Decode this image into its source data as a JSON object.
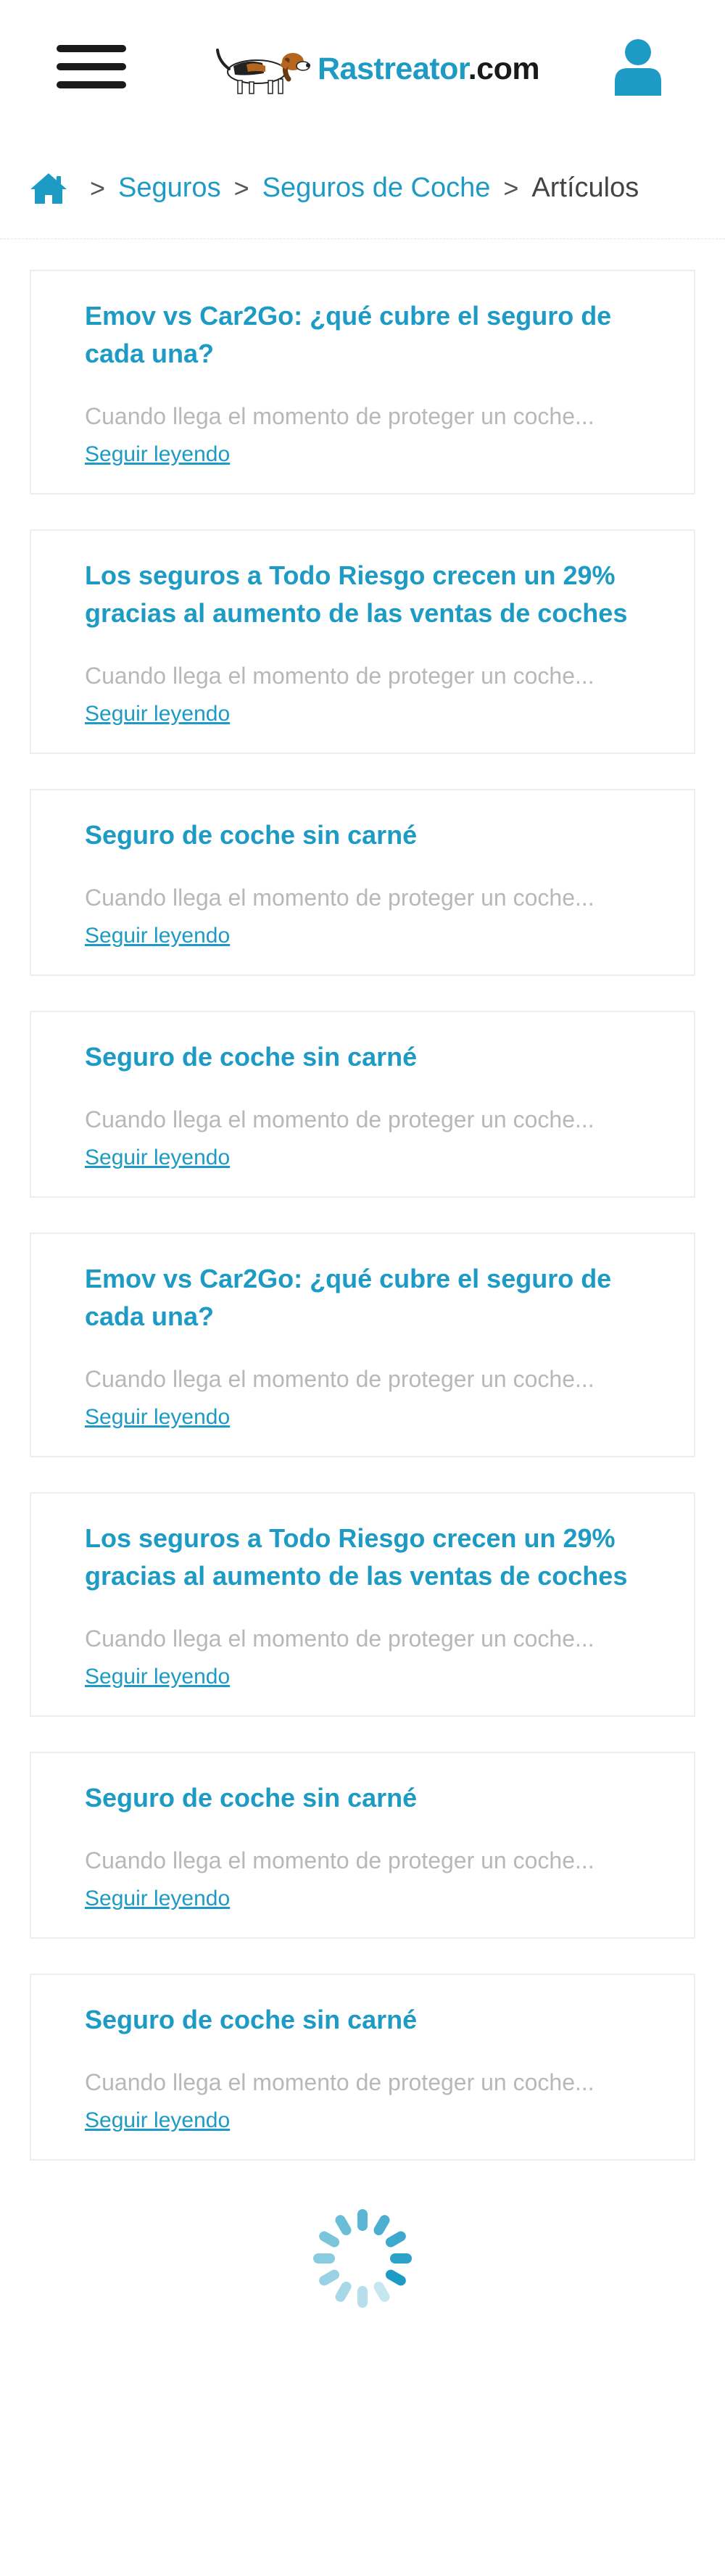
{
  "header": {
    "logo_brand": "Rastreator",
    "logo_suffix": ".com",
    "menu_icon": "hamburger-icon",
    "user_icon": "user-icon"
  },
  "breadcrumb": {
    "home_icon": "home-icon",
    "separator": ">",
    "items": [
      {
        "label": "Seguros"
      },
      {
        "label": "Seguros de Coche"
      }
    ],
    "current": "Artículos"
  },
  "articles": [
    {
      "title": "Emov vs Car2Go: ¿qué cubre el seguro de cada una?",
      "excerpt": "Cuando llega el momento de proteger un coche...",
      "link": "Seguir leyendo"
    },
    {
      "title": "Los seguros a Todo Riesgo crecen un 29% gracias al aumento de las ventas de coches",
      "excerpt": "Cuando llega el momento de proteger un coche...",
      "link": "Seguir leyendo"
    },
    {
      "title": "Seguro de coche sin carné",
      "excerpt": "Cuando llega el momento de proteger un coche...",
      "link": "Seguir leyendo"
    },
    {
      "title": "Seguro de coche sin carné",
      "excerpt": "Cuando llega el momento de proteger un coche...",
      "link": "Seguir leyendo"
    },
    {
      "title": "Emov vs Car2Go: ¿qué cubre el seguro de cada una?",
      "excerpt": "Cuando llega el momento de proteger un coche...",
      "link": "Seguir leyendo"
    },
    {
      "title": "Los seguros a Todo Riesgo crecen un 29% gracias al aumento de las ventas de coches",
      "excerpt": "Cuando llega el momento de proteger un coche...",
      "link": "Seguir leyendo"
    },
    {
      "title": "Seguro de coche sin carné",
      "excerpt": "Cuando llega el momento de proteger un coche...",
      "link": "Seguir leyendo"
    },
    {
      "title": "Seguro de coche sin carné",
      "excerpt": "Cuando llega el momento de proteger un coche...",
      "link": "Seguir leyendo"
    }
  ],
  "loading": {
    "icon": "spinner-icon"
  },
  "colors": {
    "accent": "#1d9bc4",
    "text_dark": "#1a1a1a",
    "excerpt": "#b8b8b8"
  }
}
